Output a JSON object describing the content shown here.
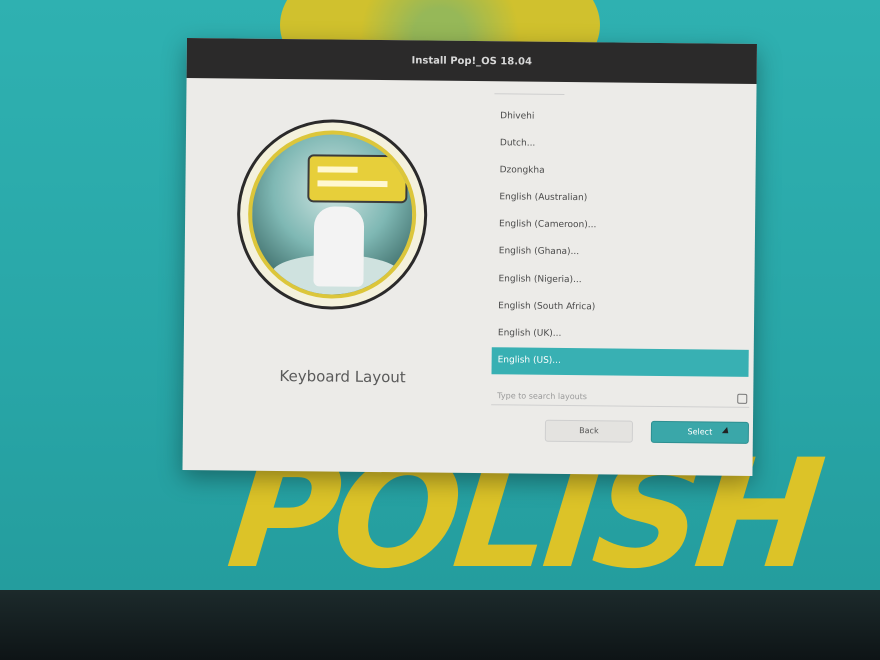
{
  "window": {
    "title": "Install Pop!_OS 18.04"
  },
  "page": {
    "heading": "Keyboard Layout"
  },
  "layouts": {
    "items": [
      "Dhivehi",
      "Dutch...",
      "Dzongkha",
      "English (Australian)",
      "English (Cameroon)...",
      "English (Ghana)...",
      "English (Nigeria)...",
      "English (South Africa)",
      "English (UK)...",
      "English (US)..."
    ],
    "selected": "English (US)..."
  },
  "search": {
    "placeholder": "Type to search layouts"
  },
  "buttons": {
    "back": "Back",
    "select": "Select"
  },
  "colors": {
    "accent": "#38b0b3",
    "titlebar": "#2b2a2a",
    "window_bg": "#ecebe8"
  }
}
